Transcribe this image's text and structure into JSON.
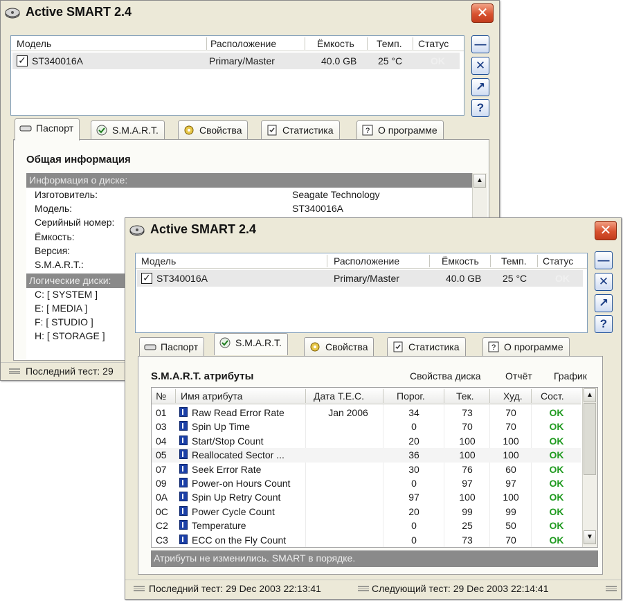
{
  "colors": {
    "window_bg": "#ece9d8",
    "close_red": "#d8522f",
    "ok_green": "#1f9a1f",
    "group_bar": "#8a8a8a"
  },
  "back_window": {
    "title": "Active SMART 2.4",
    "drive_list": {
      "headers": [
        "Модель",
        "Расположение",
        "Ёмкость",
        "Темп.",
        "Статус"
      ],
      "row": {
        "checked": "✓",
        "model": "ST340016A",
        "location": "Primary/Master",
        "capacity": "40.0 GB",
        "temp": "25 °C",
        "status": "OK"
      }
    },
    "tabs": [
      "Паспорт",
      "S.M.A.R.T.",
      "Свойства",
      "Статистика",
      "О программе"
    ],
    "passport": {
      "section_title": "Общая информация",
      "group_disk": "Информация о диске:",
      "fields": [
        {
          "label": "Изготовитель:",
          "value": "Seagate Technology"
        },
        {
          "label": "Модель:",
          "value": "ST340016A"
        },
        {
          "label": "Серийный номер:",
          "value": ""
        },
        {
          "label": "Ёмкость:",
          "value": ""
        },
        {
          "label": "Версия:",
          "value": ""
        },
        {
          "label": "S.M.A.R.T.:",
          "value": ""
        }
      ],
      "group_logical": "Логические диски:",
      "volumes": [
        "C: [ SYSTEM ]",
        "E: [ MEDIA ]",
        "F: [ STUDIO ]",
        "H: [ STORAGE ]"
      ]
    },
    "status_bar": "Последний тест: 29"
  },
  "front_window": {
    "title": "Active SMART 2.4",
    "drive_list": {
      "headers": [
        "Модель",
        "Расположение",
        "Ёмкость",
        "Темп.",
        "Статус"
      ],
      "row": {
        "checked": "✓",
        "model": "ST340016A",
        "location": "Primary/Master",
        "capacity": "40.0 GB",
        "temp": "25 °C",
        "status": "OK"
      }
    },
    "tabs": [
      "Паспорт",
      "S.M.A.R.T.",
      "Свойства",
      "Статистика",
      "О программе"
    ],
    "smart": {
      "section_title": "S.M.A.R.T. атрибуты",
      "links": [
        "Свойства диска",
        "Отчёт",
        "График"
      ],
      "columns": [
        "№",
        "Имя атрибута",
        "Дата T.E.C.",
        "Порог.",
        "Тек.",
        "Худ.",
        "Сост."
      ],
      "rows": [
        {
          "id": "01",
          "name": "Raw Read Error Rate",
          "tec": "Jan 2006",
          "thr": "34",
          "cur": "73",
          "worst": "70",
          "state": "OK"
        },
        {
          "id": "03",
          "name": "Spin Up Time",
          "tec": "",
          "thr": "0",
          "cur": "70",
          "worst": "70",
          "state": "OK"
        },
        {
          "id": "04",
          "name": "Start/Stop Count",
          "tec": "",
          "thr": "20",
          "cur": "100",
          "worst": "100",
          "state": "OK"
        },
        {
          "id": "05",
          "name": "Reallocated Sector ...",
          "tec": "",
          "thr": "36",
          "cur": "100",
          "worst": "100",
          "state": "OK"
        },
        {
          "id": "07",
          "name": "Seek Error Rate",
          "tec": "",
          "thr": "30",
          "cur": "76",
          "worst": "60",
          "state": "OK"
        },
        {
          "id": "09",
          "name": "Power-on Hours Count",
          "tec": "",
          "thr": "0",
          "cur": "97",
          "worst": "97",
          "state": "OK"
        },
        {
          "id": "0A",
          "name": "Spin Up Retry Count",
          "tec": "",
          "thr": "97",
          "cur": "100",
          "worst": "100",
          "state": "OK"
        },
        {
          "id": "0C",
          "name": "Power Cycle Count",
          "tec": "",
          "thr": "20",
          "cur": "99",
          "worst": "99",
          "state": "OK"
        },
        {
          "id": "C2",
          "name": "Temperature",
          "tec": "",
          "thr": "0",
          "cur": "25",
          "worst": "50",
          "state": "OK"
        },
        {
          "id": "C3",
          "name": "ECC on the Fly Count",
          "tec": "",
          "thr": "0",
          "cur": "73",
          "worst": "70",
          "state": "OK"
        }
      ],
      "footer_message": "Атрибуты не изменились. SMART в порядке."
    },
    "status_bar": {
      "last_test": "Последний тест: 29 Dec 2003  22:13:41",
      "next_test": "Следующий тест: 29 Dec 2003  22:14:41"
    }
  },
  "side_buttons": {
    "minimize": "—",
    "close": "✕",
    "export": "↗",
    "help": "?"
  },
  "scroll_arrows": {
    "up": "▲",
    "down": "▼"
  },
  "close_glyph": "✕"
}
